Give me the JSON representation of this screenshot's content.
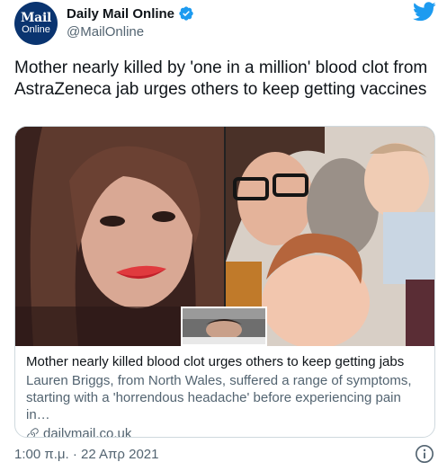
{
  "author": {
    "display_name": "Daily Mail Online",
    "handle": "@MailOnline",
    "avatar_text_line1": "Mail",
    "avatar_text_line2": "Online",
    "verified": true
  },
  "tweet": {
    "text": "Mother nearly killed by 'one in a million' blood clot from AstraZeneca jab urges others to keep getting vaccines"
  },
  "card": {
    "title": "Mother nearly killed blood clot urges others to keep getting jabs",
    "description": "Lauren Briggs, from North Wales, suffered a range of symptoms, starting with a 'horrendous headache' before experiencing pain in…",
    "domain": "dailymail.co.uk"
  },
  "footer": {
    "timestamp": "1:00 π.μ. · 22 Απρ 2021"
  },
  "icons": [
    "verified-badge-icon",
    "twitter-bird-icon",
    "link-icon",
    "info-icon"
  ],
  "colors": {
    "verified_blue": "#1d9bf0",
    "twitter_blue": "#1d9bf0",
    "secondary_text": "#536471",
    "avatar_bg": "#0a3470"
  }
}
